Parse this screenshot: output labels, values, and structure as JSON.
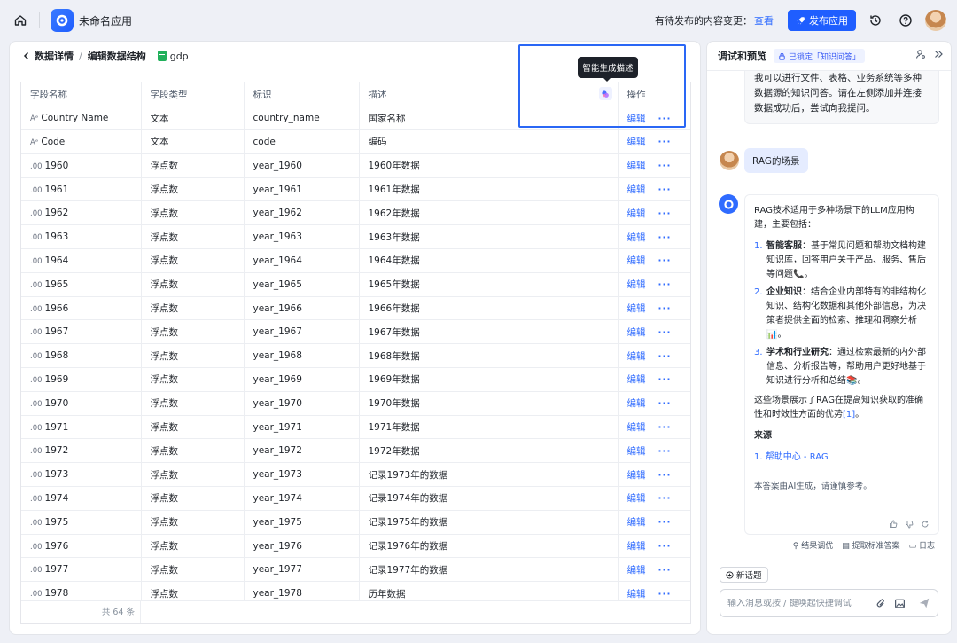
{
  "topbar": {
    "app_name": "未命名应用",
    "pending_text": "有待发布的内容变更：",
    "pending_link": "查看",
    "publish_label": "发布应用"
  },
  "breadcrumb": {
    "back": "数据详情",
    "edit": "编辑数据结构",
    "file": "gdp"
  },
  "table": {
    "headers": [
      "字段名称",
      "字段类型",
      "标识",
      "描述",
      "操作"
    ],
    "edit_label": "编辑",
    "more_label": "···",
    "rows": [
      {
        "icon": "Aᵉ",
        "name": "Country Name",
        "type": "文本",
        "id": "country_name",
        "desc": "国家名称"
      },
      {
        "icon": "Aᵉ",
        "name": "Code",
        "type": "文本",
        "id": "code",
        "desc": "编码"
      },
      {
        "icon": ".00",
        "name": "1960",
        "type": "浮点数",
        "id": "year_1960",
        "desc": "1960年数据"
      },
      {
        "icon": ".00",
        "name": "1961",
        "type": "浮点数",
        "id": "year_1961",
        "desc": "1961年数据"
      },
      {
        "icon": ".00",
        "name": "1962",
        "type": "浮点数",
        "id": "year_1962",
        "desc": "1962年数据"
      },
      {
        "icon": ".00",
        "name": "1963",
        "type": "浮点数",
        "id": "year_1963",
        "desc": "1963年数据"
      },
      {
        "icon": ".00",
        "name": "1964",
        "type": "浮点数",
        "id": "year_1964",
        "desc": "1964年数据"
      },
      {
        "icon": ".00",
        "name": "1965",
        "type": "浮点数",
        "id": "year_1965",
        "desc": "1965年数据"
      },
      {
        "icon": ".00",
        "name": "1966",
        "type": "浮点数",
        "id": "year_1966",
        "desc": "1966年数据"
      },
      {
        "icon": ".00",
        "name": "1967",
        "type": "浮点数",
        "id": "year_1967",
        "desc": "1967年数据"
      },
      {
        "icon": ".00",
        "name": "1968",
        "type": "浮点数",
        "id": "year_1968",
        "desc": "1968年数据"
      },
      {
        "icon": ".00",
        "name": "1969",
        "type": "浮点数",
        "id": "year_1969",
        "desc": "1969年数据"
      },
      {
        "icon": ".00",
        "name": "1970",
        "type": "浮点数",
        "id": "year_1970",
        "desc": "1970年数据"
      },
      {
        "icon": ".00",
        "name": "1971",
        "type": "浮点数",
        "id": "year_1971",
        "desc": "1971年数据"
      },
      {
        "icon": ".00",
        "name": "1972",
        "type": "浮点数",
        "id": "year_1972",
        "desc": "1972年数据"
      },
      {
        "icon": ".00",
        "name": "1973",
        "type": "浮点数",
        "id": "year_1973",
        "desc": "记录1973年的数据"
      },
      {
        "icon": ".00",
        "name": "1974",
        "type": "浮点数",
        "id": "year_1974",
        "desc": "记录1974年的数据"
      },
      {
        "icon": ".00",
        "name": "1975",
        "type": "浮点数",
        "id": "year_1975",
        "desc": "记录1975年的数据"
      },
      {
        "icon": ".00",
        "name": "1976",
        "type": "浮点数",
        "id": "year_1976",
        "desc": "记录1976年的数据"
      },
      {
        "icon": ".00",
        "name": "1977",
        "type": "浮点数",
        "id": "year_1977",
        "desc": "记录1977年的数据"
      },
      {
        "icon": ".00",
        "name": "1978",
        "type": "浮点数",
        "id": "year_1978",
        "desc": "历年数据"
      }
    ],
    "total": "共 64 条"
  },
  "tooltip": "智能生成描述",
  "preview": {
    "title": "调试和预览",
    "lock_badge": "已锁定「知识问答」",
    "intro": "我可以进行文件、表格、业务系统等多种数据源的知识问答。请在左侧添加并连接数据成功后，尝试向我提问。",
    "user_message": "RAG的场景",
    "answer_intro": "RAG技术适用于多种场景下的LLM应用构建，主要包括：",
    "items": [
      {
        "num": "1.",
        "title": "智能客服",
        "text": "：基于常见问题和帮助文档构建知识库，回答用户关于产品、服务、售后等问题📞。"
      },
      {
        "num": "2.",
        "title": "企业知识",
        "text": "：结合企业内部特有的非结构化知识、结构化数据和其他外部信息，为决策者提供全面的检索、推理和洞察分析📊。"
      },
      {
        "num": "3.",
        "title": "学术和行业研究",
        "text": "：通过检索最新的内外部信息、分析报告等，帮助用户更好地基于知识进行分析和总结📚。"
      }
    ],
    "answer_outro": "这些场景展示了RAG在提高知识获取的准确性和时效性方面的优势",
    "citation": "[1]",
    "outro_end": "。",
    "source_title": "来源",
    "source_num": "1.",
    "source_link": "帮助中心 - RAG",
    "ai_note": "本答案由AI生成，请谨慎参考。",
    "tools": [
      "结果调优",
      "提取标准答案",
      "日志"
    ],
    "new_topic": "新话题",
    "input_placeholder": "输入消息或按 / 键唤起快捷调试"
  }
}
